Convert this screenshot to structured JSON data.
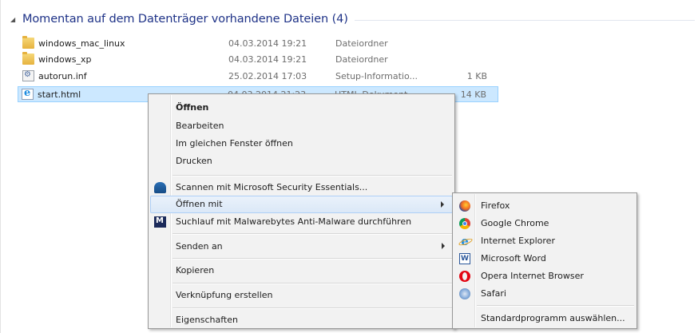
{
  "group": {
    "title": "Momentan auf dem Datenträger vorhandene Dateien (4)"
  },
  "files": [
    {
      "name": "windows_mac_linux",
      "date": "04.03.2014 19:21",
      "type": "Dateiordner",
      "size": "",
      "icon": "folder-icon"
    },
    {
      "name": "windows_xp",
      "date": "04.03.2014 19:21",
      "type": "Dateiordner",
      "size": "",
      "icon": "folder-icon"
    },
    {
      "name": "autorun.inf",
      "date": "25.02.2014 17:03",
      "type": "Setup-Informatio...",
      "size": "1 KB",
      "icon": "setup-info-icon"
    },
    {
      "name": "start.html",
      "date": "04.03.2014 21:23",
      "type": "HTML-Dokument",
      "size": "14 KB",
      "icon": "html-document-icon"
    }
  ],
  "context_menu": {
    "open": "Öffnen",
    "edit": "Bearbeiten",
    "open_same_window": "Im gleichen Fenster öffnen",
    "print": "Drucken",
    "scan_mse": "Scannen mit Microsoft Security Essentials...",
    "open_with": "Öffnen mit",
    "scan_mbam": "Suchlauf mit Malwarebytes Anti-Malware durchführen",
    "send_to": "Senden an",
    "copy": "Kopieren",
    "create_shortcut": "Verknüpfung erstellen",
    "properties": "Eigenschaften"
  },
  "open_with_menu": {
    "items": [
      "Firefox",
      "Google Chrome",
      "Internet Explorer",
      "Microsoft Word",
      "Opera Internet Browser",
      "Safari"
    ],
    "choose_default": "Standardprogramm auswählen..."
  },
  "colors": {
    "group_title": "#1e3287",
    "selection": "#cce8ff",
    "menu_bg": "#f2f2f2"
  }
}
